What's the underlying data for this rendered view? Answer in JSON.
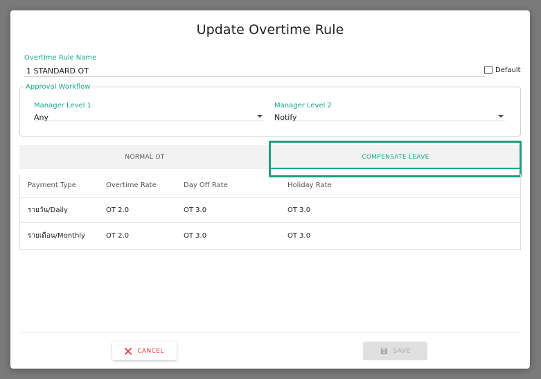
{
  "dialog": {
    "title": "Update Overtime Rule"
  },
  "rule_name": {
    "label": "Overtime Rule Name",
    "value": "1 STANDARD OT"
  },
  "default_checkbox": {
    "label": "Default",
    "checked": false
  },
  "approval_workflow": {
    "legend": "Approval Workflow",
    "manager_level_1": {
      "label": "Manager Level 1",
      "value": "Any"
    },
    "manager_level_2": {
      "label": "Manager Level 2",
      "value": "Notify"
    }
  },
  "tabs": [
    {
      "label": "NORMAL OT",
      "active": false
    },
    {
      "label": "COMPENSATE LEAVE",
      "active": true
    }
  ],
  "table": {
    "headers": [
      "Payment Type",
      "Overtime Rate",
      "Day Off Rate",
      "Holiday Rate"
    ],
    "rows": [
      [
        "รายวัน/Daily",
        "OT 2.0",
        "OT 3.0",
        "OT 3.0"
      ],
      [
        "รายเดือน/Monthly",
        "OT 2.0",
        "OT 3.0",
        "OT 3.0"
      ]
    ]
  },
  "buttons": {
    "cancel": {
      "label": "CANCEL",
      "icon": "close-icon"
    },
    "save": {
      "label": "SAVE",
      "icon": "floppy-disk-icon",
      "disabled": true
    }
  },
  "colors": {
    "accent": "#1aa68f",
    "cancel": "#e53935",
    "overlay": "#7a7a7a"
  }
}
